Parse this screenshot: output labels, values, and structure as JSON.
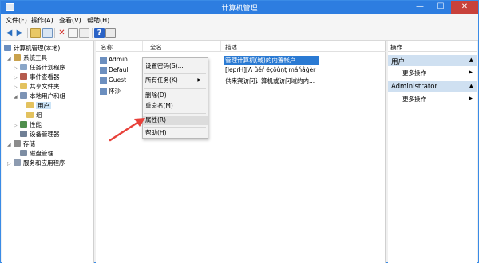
{
  "window": {
    "title": "计算机管理",
    "min": "—",
    "max": "☐",
    "close": "✕"
  },
  "menu": [
    {
      "label": "文件(F)"
    },
    {
      "label": "操作(A)"
    },
    {
      "label": "查看(V)"
    },
    {
      "label": "帮助(H)"
    }
  ],
  "tree": [
    {
      "label": "计算机管理(本地)",
      "icon": "computer-icon"
    },
    {
      "label": "系统工具",
      "icon": "tools-icon"
    },
    {
      "label": "任务计划程序",
      "icon": "clock-icon"
    },
    {
      "label": "事件查看器",
      "icon": "event-icon"
    },
    {
      "label": "共享文件夹",
      "icon": "folder-icon"
    },
    {
      "label": "本地用户和组",
      "icon": "users-icon"
    },
    {
      "label": "用户",
      "icon": "folder-icon"
    },
    {
      "label": "组",
      "icon": "folder-icon"
    },
    {
      "label": "性能",
      "icon": "perf-icon"
    },
    {
      "label": "设备管理器",
      "icon": "device-icon"
    },
    {
      "label": "存储",
      "icon": "storage-icon"
    },
    {
      "label": "磁盘管理",
      "icon": "disk-icon"
    },
    {
      "label": "服务和应用程序",
      "icon": "services-icon"
    }
  ],
  "list": {
    "headers": {
      "name": "名称",
      "fullname": "全名",
      "desc": "描述"
    },
    "rows": [
      {
        "name": "Admin",
        "fullname": "",
        "desc": "管理计算机(域)的内置帐户"
      },
      {
        "name": "Defaul",
        "fullname": "",
        "desc": "[leprH][Λ ûéŕ ëçôûņţ máńâģèr"
      },
      {
        "name": "Guest",
        "fullname": "",
        "desc": "供来宾访问计算机或访问域的内..."
      },
      {
        "name": "怀沙",
        "fullname": "",
        "desc": ""
      }
    ]
  },
  "context_menu": {
    "items": [
      {
        "label": "设置密码(S)..."
      },
      {
        "label": "所有任务(K)",
        "arrow": "▶"
      },
      {
        "label": "删除(D)"
      },
      {
        "label": "重命名(M)"
      },
      {
        "label": "属性(R)"
      },
      {
        "label": "帮助(H)"
      }
    ]
  },
  "actions": {
    "header": "操作",
    "sections": [
      {
        "title": "用户",
        "arrow": "▲",
        "more": "更多操作",
        "more_arrow": "▶"
      },
      {
        "title": "Administrator",
        "arrow": "▲",
        "more": "更多操作",
        "more_arrow": "▶"
      }
    ]
  },
  "colors": {
    "titlebar": "#2d7de0",
    "selection": "#2a7ad3",
    "arrow": "#e8413a"
  }
}
